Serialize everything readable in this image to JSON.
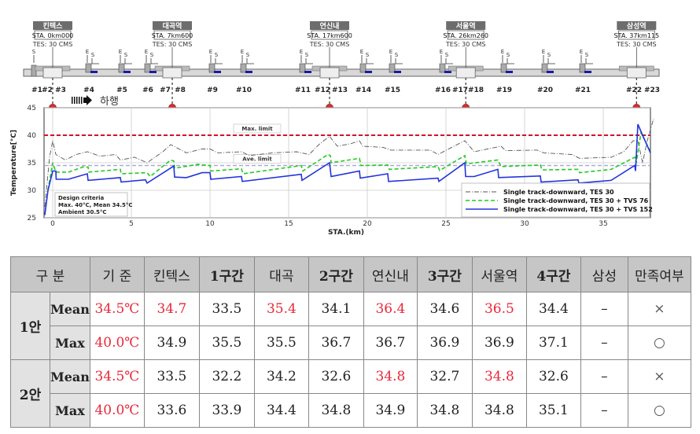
{
  "schematic": {
    "direction_label": "하행",
    "exhaust_label": "E",
    "supply_label": "S",
    "stations": [
      {
        "name": "킨텍스",
        "sta": "STA. 0km000",
        "tes": "TES: 30 CMS",
        "km": 0
      },
      {
        "name": "대곡역",
        "sta": "STA. 7km600",
        "tes": "TES: 30 CMS",
        "km": 7.6
      },
      {
        "name": "연신내",
        "sta": "STA. 17km600",
        "tes": "TES: 30 CMS",
        "km": 17.6
      },
      {
        "name": "서울역",
        "sta": "STA. 26km260",
        "tes": "TES: 30 CMS",
        "km": 26.26
      },
      {
        "name": "삼성역",
        "sta": "STA. 37km115",
        "tes": "TES: 30 CMS",
        "km": 37.115
      }
    ],
    "vents": [
      "#1",
      "#2",
      "#3",
      "#4",
      "#5",
      "#6",
      "#7",
      "#8",
      "#9",
      "#10",
      "#11",
      "#12",
      "#13",
      "#14",
      "#15",
      "#16",
      "#17",
      "#18",
      "#19",
      "#20",
      "#21",
      "#22",
      "#23"
    ]
  },
  "chart_data": {
    "type": "line",
    "xlabel": "STA.(km)",
    "ylabel": "Temperature[°C]",
    "xlim": [
      -0.5,
      38.2
    ],
    "ylim": [
      25,
      45
    ],
    "xticks": [
      0,
      5,
      10,
      15,
      20,
      25,
      30,
      35
    ],
    "yticks": [
      25,
      30,
      35,
      40,
      45
    ],
    "grid": true,
    "legend_position": "bottom-right",
    "reference_lines": [
      {
        "label": "Max. limit",
        "y": 40,
        "color": "#d0142c"
      },
      {
        "label": "Ave. limit",
        "y": 34.5,
        "color": "#a9a9d8"
      }
    ],
    "annotation": [
      "Design criteria",
      "Max. 40°C, Mean 34.5°C",
      "Ambient 30.5°C"
    ],
    "series": [
      {
        "name": "Single track-downward, TES 30",
        "color": "#555555",
        "style": "dashdot",
        "points": [
          [
            -0.5,
            27
          ],
          [
            -0.2,
            36
          ],
          [
            0,
            39
          ],
          [
            0.2,
            36.5
          ],
          [
            0.8,
            35.5
          ],
          [
            1.5,
            36.5
          ],
          [
            2.2,
            37
          ],
          [
            3,
            36.2
          ],
          [
            4,
            36.5
          ],
          [
            4.3,
            35.5
          ],
          [
            5.2,
            36
          ],
          [
            6,
            35
          ],
          [
            7,
            37
          ],
          [
            7.5,
            38.3
          ],
          [
            8.5,
            36.8
          ],
          [
            9.5,
            37.5
          ],
          [
            10,
            37.5
          ],
          [
            10.5,
            36.8
          ],
          [
            12,
            37
          ],
          [
            12.5,
            36.3
          ],
          [
            14,
            36.8
          ],
          [
            15.5,
            37
          ],
          [
            16.3,
            36.5
          ],
          [
            17,
            38.5
          ],
          [
            17.6,
            39.8
          ],
          [
            18.1,
            38
          ],
          [
            19,
            38.5
          ],
          [
            19.5,
            39
          ],
          [
            19.7,
            38
          ],
          [
            21,
            37.8
          ],
          [
            21.5,
            37.3
          ],
          [
            24,
            37.3
          ],
          [
            24.5,
            36.5
          ],
          [
            25.5,
            38
          ],
          [
            26.2,
            39
          ],
          [
            26.8,
            37
          ],
          [
            28.5,
            38
          ],
          [
            28.8,
            37.2
          ],
          [
            30.8,
            37.3
          ],
          [
            31.2,
            36.8
          ],
          [
            33,
            36.5
          ],
          [
            33.5,
            35.8
          ],
          [
            35.5,
            36
          ],
          [
            36.3,
            37
          ],
          [
            36.9,
            39
          ],
          [
            37.2,
            39
          ],
          [
            37.5,
            35
          ],
          [
            37.8,
            39
          ],
          [
            38.2,
            43
          ]
        ]
      },
      {
        "name": "Single track-downward, TES 30 + TVS 76",
        "color": "#22cc22",
        "style": "dashed",
        "points": [
          [
            -0.3,
            30
          ],
          [
            0,
            35
          ],
          [
            0.2,
            33.3
          ],
          [
            1,
            33.3
          ],
          [
            2,
            34.3
          ],
          [
            2.25,
            34.2
          ],
          [
            2.3,
            33.3
          ],
          [
            4.3,
            33.8
          ],
          [
            4.35,
            33
          ],
          [
            6,
            33.2
          ],
          [
            6.2,
            32.5
          ],
          [
            7.5,
            35.5
          ],
          [
            7.7,
            35.3
          ],
          [
            7.75,
            34
          ],
          [
            9.2,
            34.7
          ],
          [
            10,
            34.5
          ],
          [
            10.05,
            33.5
          ],
          [
            12,
            33.9
          ],
          [
            12.1,
            33
          ],
          [
            15.8,
            34.5
          ],
          [
            15.9,
            33.5
          ],
          [
            17.5,
            36.5
          ],
          [
            17.65,
            36.3
          ],
          [
            17.7,
            35
          ],
          [
            19.5,
            35.8
          ],
          [
            19.6,
            34.5
          ],
          [
            21.3,
            34.6
          ],
          [
            21.4,
            33.8
          ],
          [
            24.5,
            34.3
          ],
          [
            24.6,
            33.6
          ],
          [
            26.2,
            36.3
          ],
          [
            26.3,
            34.8
          ],
          [
            28.3,
            35.5
          ],
          [
            28.5,
            34.3
          ],
          [
            31,
            34.6
          ],
          [
            31.1,
            33.7
          ],
          [
            33.4,
            33.8
          ],
          [
            33.5,
            33.2
          ],
          [
            35.5,
            33.8
          ],
          [
            37,
            36
          ],
          [
            37.1,
            35
          ],
          [
            37.4,
            40.5
          ],
          [
            38,
            37
          ]
        ]
      },
      {
        "name": "Single track-downward, TES 30 + TVS 152",
        "color": "#2233dd",
        "style": "solid",
        "points": [
          [
            -0.5,
            25.5
          ],
          [
            -0.3,
            30
          ],
          [
            0,
            33.5
          ],
          [
            0.2,
            33.5
          ],
          [
            0.22,
            32
          ],
          [
            1,
            32
          ],
          [
            2.2,
            33
          ],
          [
            2.25,
            31.8
          ],
          [
            4.3,
            32.3
          ],
          [
            4.35,
            31.5
          ],
          [
            5.9,
            31.9
          ],
          [
            6,
            31.3
          ],
          [
            7.7,
            34.4
          ],
          [
            7.75,
            32.4
          ],
          [
            8.5,
            32.3
          ],
          [
            9.5,
            33.2
          ],
          [
            10,
            33.2
          ],
          [
            10.05,
            32
          ],
          [
            12,
            32.5
          ],
          [
            12.05,
            31.6
          ],
          [
            15.8,
            32.9
          ],
          [
            15.85,
            31.8
          ],
          [
            17.6,
            35
          ],
          [
            17.7,
            32.5
          ],
          [
            19.5,
            33.5
          ],
          [
            19.55,
            32.2
          ],
          [
            21.3,
            33
          ],
          [
            21.35,
            31.6
          ],
          [
            24.5,
            32.2
          ],
          [
            24.55,
            31.6
          ],
          [
            26.2,
            35
          ],
          [
            26.25,
            32.5
          ],
          [
            26.8,
            32.5
          ],
          [
            28.3,
            33.8
          ],
          [
            28.35,
            32.3
          ],
          [
            31,
            32.6
          ],
          [
            31.05,
            31.5
          ],
          [
            33.4,
            31.9
          ],
          [
            33.45,
            31.3
          ],
          [
            35.5,
            31.8
          ],
          [
            37,
            34.5
          ],
          [
            37.05,
            33.5
          ],
          [
            37.2,
            42
          ],
          [
            37.5,
            40
          ],
          [
            38,
            36.8
          ]
        ]
      }
    ]
  },
  "table": {
    "headers": [
      "구 분",
      "기 준",
      "킨텍스",
      "1구간",
      "대곡",
      "2구간",
      "연신내",
      "3구간",
      "서울역",
      "4구간",
      "삼성",
      "만족여부"
    ],
    "groups": [
      {
        "label": "1안",
        "rows": [
          {
            "label": "Mean",
            "values": [
              "34.5℃",
              "34.7",
              "33.5",
              "35.4",
              "34.1",
              "36.4",
              "34.6",
              "36.5",
              "34.4",
              "–",
              "×"
            ],
            "red": [
              0,
              1,
              3,
              5,
              7
            ]
          },
          {
            "label": "Max",
            "values": [
              "40.0℃",
              "34.9",
              "35.5",
              "35.5",
              "36.7",
              "36.7",
              "36.9",
              "36.9",
              "37.1",
              "–",
              "○"
            ],
            "red": [
              0
            ]
          }
        ]
      },
      {
        "label": "2안",
        "rows": [
          {
            "label": "Mean",
            "values": [
              "34.5℃",
              "33.5",
              "32.2",
              "34.2",
              "32.6",
              "34.8",
              "32.7",
              "34.8",
              "32.6",
              "–",
              "×"
            ],
            "red": [
              0,
              5,
              7
            ]
          },
          {
            "label": "Max",
            "values": [
              "40.0℃",
              "33.6",
              "33.9",
              "34.4",
              "34.8",
              "34.9",
              "34.8",
              "34.8",
              "35.1",
              "–",
              "○"
            ],
            "red": [
              0
            ]
          }
        ]
      }
    ]
  }
}
